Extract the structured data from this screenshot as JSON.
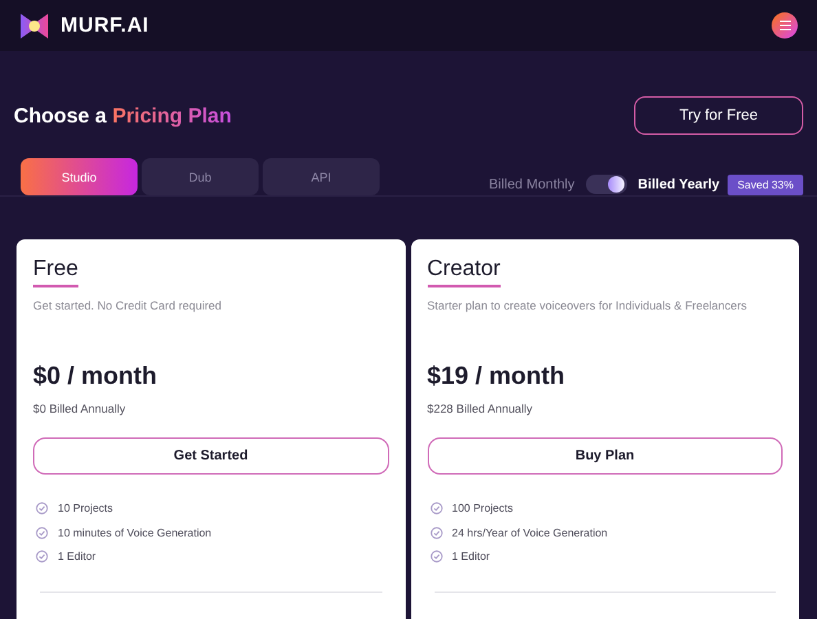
{
  "header": {
    "brand": "MURF.AI"
  },
  "heading": {
    "text": "Choose a",
    "highlight": "Pricing Plan"
  },
  "try_button": "Try for Free",
  "tabs": [
    {
      "label": "Studio",
      "selected": true
    },
    {
      "label": "Dub",
      "selected": false
    },
    {
      "label": "API",
      "selected": false
    }
  ],
  "billing": {
    "monthly_label": "Billed Monthly",
    "yearly_label": "Billed Yearly",
    "yearly_selected": true,
    "badge": "Saved 33%"
  },
  "plans": [
    {
      "name": "Free",
      "description": "Get started. No Credit Card required",
      "price": "$0 / month",
      "annual": "$0 Billed Annually",
      "button": "Get Started",
      "features": [
        "10 Projects",
        "10 minutes of Voice Generation",
        "1 Editor"
      ]
    },
    {
      "name": "Creator",
      "description": "Starter plan to create voiceovers for Individuals & Freelancers",
      "price": "$19 / month",
      "annual": "$228 Billed Annually",
      "button": "Buy Plan",
      "features": [
        "100 Projects",
        "24 hrs/Year of Voice Generation",
        "1 Editor"
      ]
    }
  ]
}
